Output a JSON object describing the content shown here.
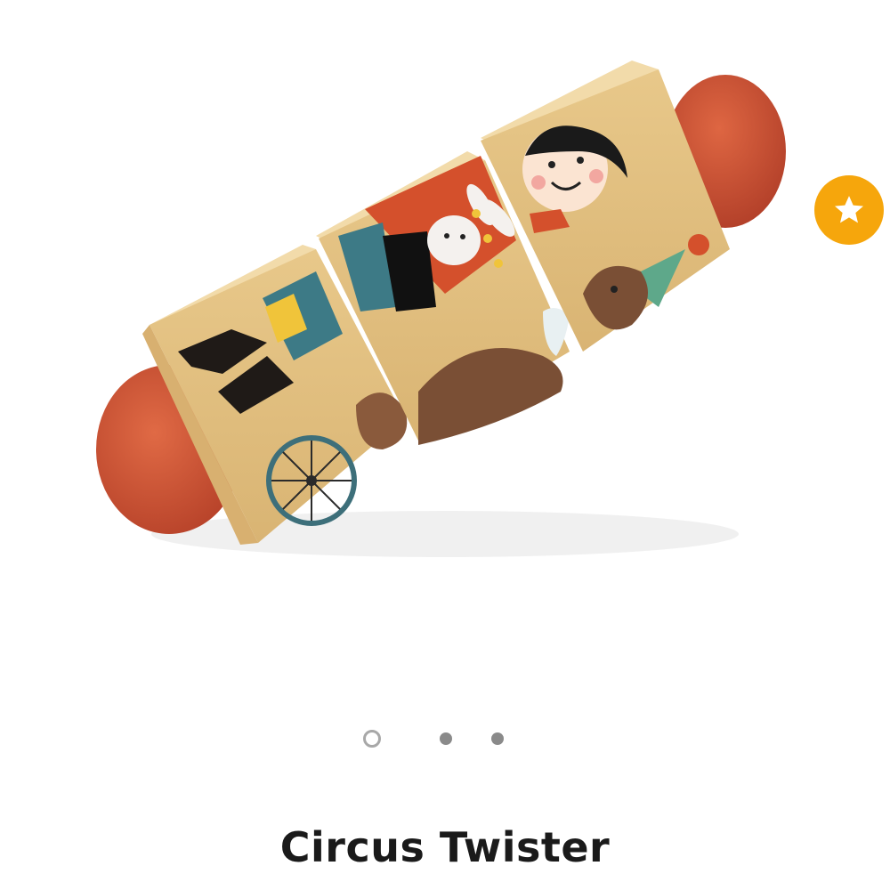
{
  "product": {
    "title": "Circus Twister",
    "image_icon": "wooden-circus-twister-toy-image"
  },
  "favorite": {
    "icon": "star-icon",
    "color": "#f6a60c"
  },
  "carousel": {
    "total": 3,
    "active_index": 0
  },
  "colors": {
    "wood": "#e8c88a",
    "end_caps": "#c9502f",
    "title_text": "#1a1a1a"
  }
}
